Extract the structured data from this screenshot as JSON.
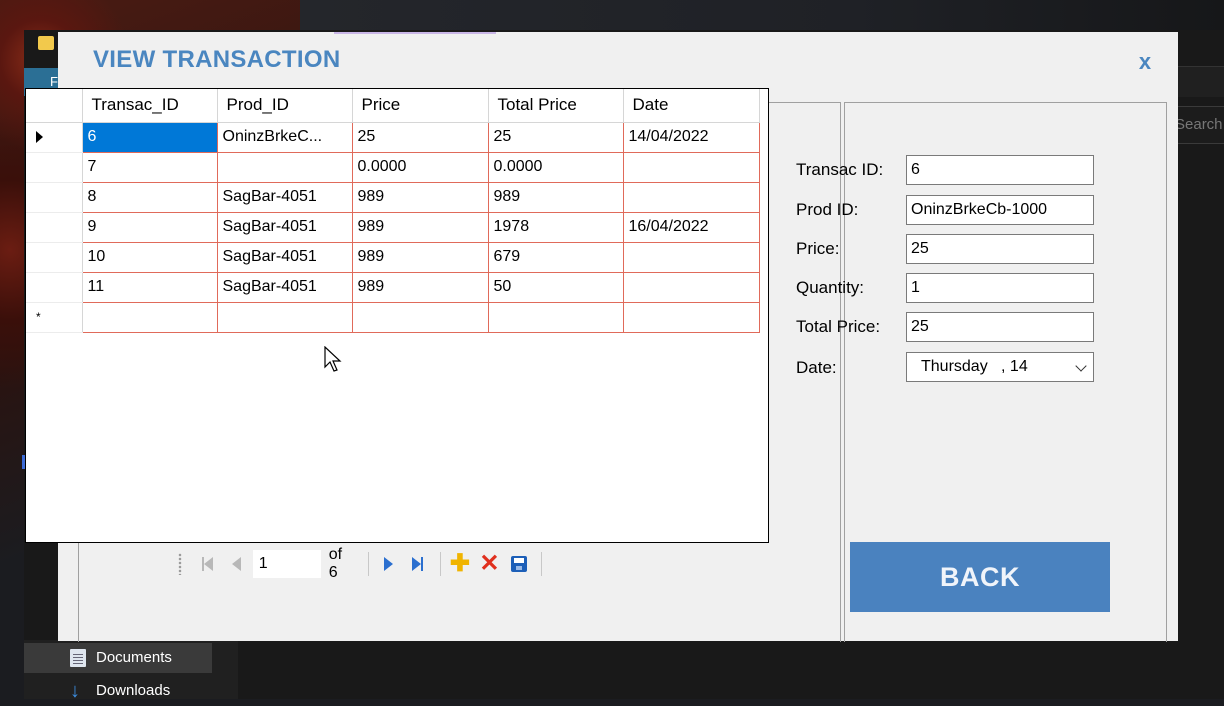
{
  "background": {
    "ribbon_tab": "F",
    "search_placeholder": "Search",
    "nav_items": [
      "Documents",
      "Downloads"
    ]
  },
  "dialog": {
    "title": "VIEW TRANSACTION",
    "close": "x"
  },
  "grid": {
    "columns": [
      "Transac_ID",
      "Prod_ID",
      "Price",
      "Total Price",
      "Date"
    ],
    "rows": [
      [
        "6",
        "OninzBrkeC...",
        "25",
        "25",
        "14/04/2022"
      ],
      [
        "7",
        "",
        "0.0000",
        "0.0000",
        ""
      ],
      [
        "8",
        "SagBar-4051",
        "989",
        "989",
        ""
      ],
      [
        "9",
        "SagBar-4051",
        "989",
        "1978",
        "16/04/2022"
      ],
      [
        "10",
        "SagBar-4051",
        "989",
        "679",
        ""
      ],
      [
        "11",
        "SagBar-4051",
        "989",
        "50",
        ""
      ]
    ],
    "new_row_marker": "*"
  },
  "navigator": {
    "position": "1",
    "count_label": "of 6"
  },
  "form": {
    "transac_id_label": "Transac ID:",
    "transac_id_value": "6",
    "prod_id_label": "Prod ID:",
    "prod_id_value": "OninzBrkeCb-1000",
    "price_label": "Price:",
    "price_value": "25",
    "quantity_label": "Quantity:",
    "quantity_value": "1",
    "total_price_label": "Total Price:",
    "total_price_value": "25",
    "date_label": "Date:",
    "date_value": "Thursday   , 14"
  },
  "back_button": "BACK",
  "colors": {
    "accent": "#4a82bf",
    "selection": "#0078d7",
    "grid_border": "#e06a5a"
  }
}
